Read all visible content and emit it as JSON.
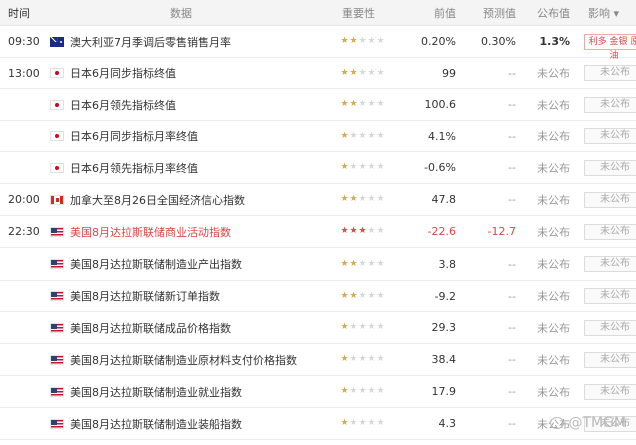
{
  "header": {
    "time": "时间",
    "data": "数据",
    "importance": "重要性",
    "previous": "前值",
    "forecast": "预测值",
    "actual": "公布值",
    "effect": "影响 ▾"
  },
  "rows": [
    {
      "time": "09:30",
      "flag": "au",
      "name": "澳大利亚7月季调后零售销售月率",
      "stars": 2,
      "prev": "0.20%",
      "fore": "0.30%",
      "actual": "1.3%",
      "actual_bold": true,
      "effect": "利多 金银 原油",
      "effect_hi": true
    },
    {
      "time": "13:00",
      "flag": "jp",
      "name": "日本6月同步指标终值",
      "stars": 2,
      "prev": "99",
      "fore": "--",
      "actual": "未公布",
      "effect": "未公布"
    },
    {
      "time": "",
      "flag": "jp",
      "name": "日本6月领先指标终值",
      "stars": 2,
      "prev": "100.6",
      "fore": "--",
      "actual": "未公布",
      "effect": "未公布"
    },
    {
      "time": "",
      "flag": "jp",
      "name": "日本6月同步指标月率终值",
      "stars": 1,
      "prev": "4.1%",
      "fore": "--",
      "actual": "未公布",
      "effect": "未公布"
    },
    {
      "time": "",
      "flag": "jp",
      "name": "日本6月领先指标月率终值",
      "stars": 1,
      "prev": "-0.6%",
      "fore": "--",
      "actual": "未公布",
      "effect": "未公布"
    },
    {
      "time": "20:00",
      "flag": "ca",
      "name": "加拿大至8月26日全国经济信心指数",
      "stars": 2,
      "prev": "47.8",
      "fore": "--",
      "actual": "未公布",
      "effect": "未公布"
    },
    {
      "time": "22:30",
      "flag": "us",
      "name": "美国8月达拉斯联储商业活动指数",
      "stars": 3,
      "hot": true,
      "prev": "-22.6",
      "fore": "-12.7",
      "actual": "未公布",
      "effect": "未公布"
    },
    {
      "time": "",
      "flag": "us",
      "name": "美国8月达拉斯联储制造业产出指数",
      "stars": 2,
      "prev": "3.8",
      "fore": "--",
      "actual": "未公布",
      "effect": "未公布"
    },
    {
      "time": "",
      "flag": "us",
      "name": "美国8月达拉斯联储新订单指数",
      "stars": 2,
      "prev": "-9.2",
      "fore": "--",
      "actual": "未公布",
      "effect": "未公布"
    },
    {
      "time": "",
      "flag": "us",
      "name": "美国8月达拉斯联储成品价格指数",
      "stars": 1,
      "prev": "29.3",
      "fore": "--",
      "actual": "未公布",
      "effect": "未公布"
    },
    {
      "time": "",
      "flag": "us",
      "name": "美国8月达拉斯联储制造业原材料支付价格指数",
      "stars": 1,
      "prev": "38.4",
      "fore": "--",
      "actual": "未公布",
      "effect": "未公布"
    },
    {
      "time": "",
      "flag": "us",
      "name": "美国8月达拉斯联储制造业就业指数",
      "stars": 1,
      "prev": "17.9",
      "fore": "--",
      "actual": "未公布",
      "effect": "未公布"
    },
    {
      "time": "",
      "flag": "us",
      "name": "美国8月达拉斯联储制造业装船指数",
      "stars": 1,
      "prev": "4.3",
      "fore": "--",
      "actual": "未公布",
      "effect": "未公布"
    }
  ],
  "watermark": "@TMGM",
  "colors": {
    "accent_red": "#e04545",
    "star_gold": "#d6a94a",
    "star_hot": "#d94a4a"
  }
}
